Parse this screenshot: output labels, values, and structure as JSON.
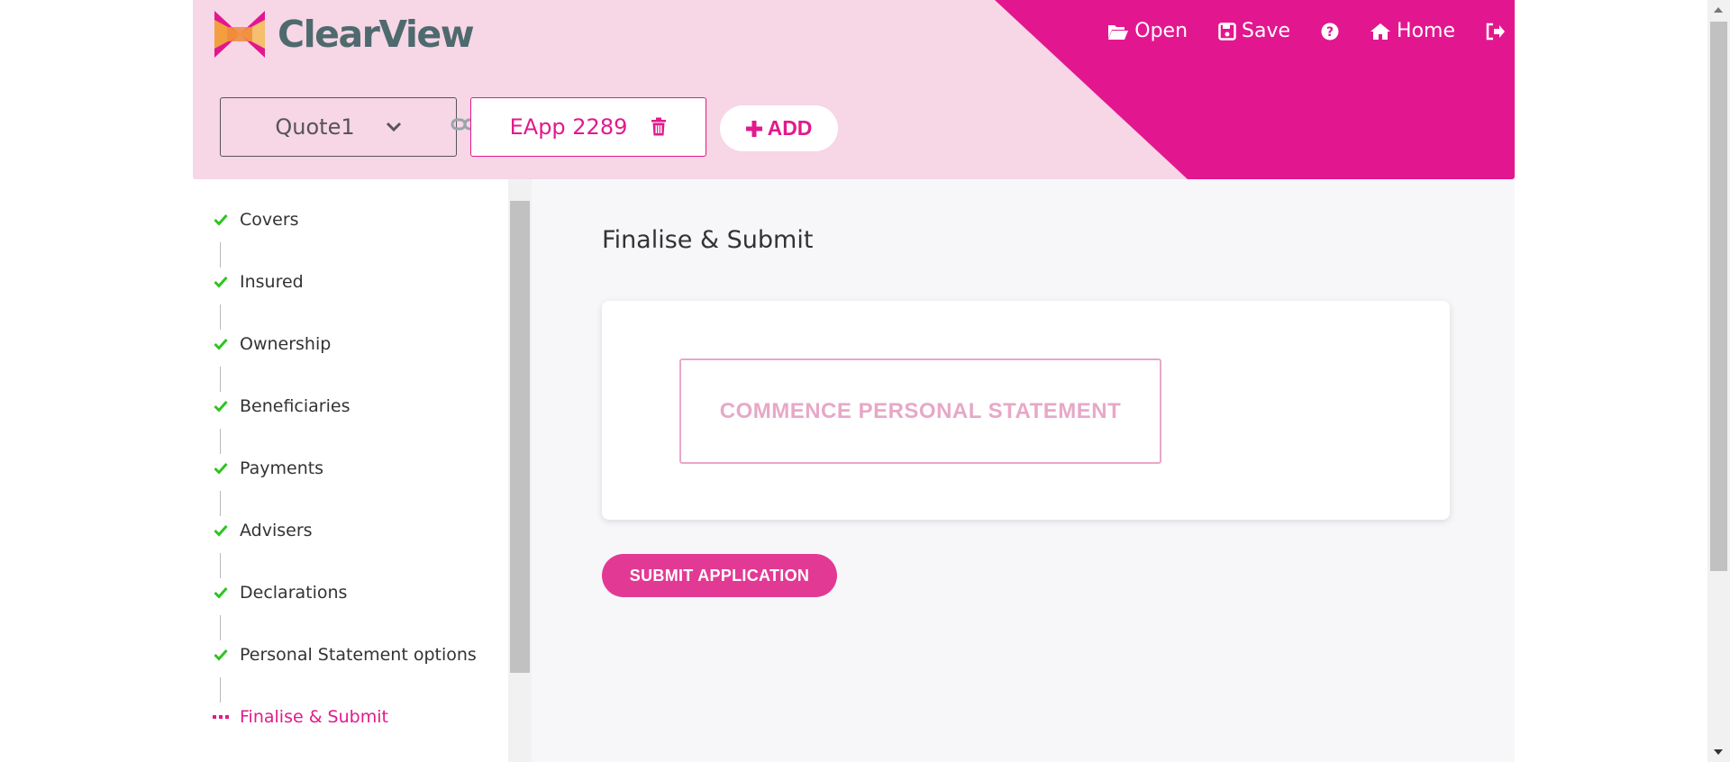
{
  "brand": {
    "name": "ClearView"
  },
  "top_nav": {
    "open_label": "Open",
    "save_label": "Save",
    "home_label": "Home"
  },
  "toolbar": {
    "quote_select_value": "Quote1",
    "eapp_label": "EApp 2289",
    "add_label": "ADD"
  },
  "sidebar": {
    "steps": [
      {
        "label": "Covers",
        "status": "complete"
      },
      {
        "label": "Insured",
        "status": "complete"
      },
      {
        "label": "Ownership",
        "status": "complete"
      },
      {
        "label": "Beneficiaries",
        "status": "complete"
      },
      {
        "label": "Payments",
        "status": "complete"
      },
      {
        "label": "Advisers",
        "status": "complete"
      },
      {
        "label": "Declarations",
        "status": "complete"
      },
      {
        "label": "Personal Statement options",
        "status": "complete"
      },
      {
        "label": "Finalise & Submit",
        "status": "current"
      }
    ]
  },
  "main": {
    "title": "Finalise & Submit",
    "commence_label": "COMMENCE PERSONAL STATEMENT",
    "submit_label": "SUBMIT APPLICATION"
  },
  "colors": {
    "accent": "#e21a8c",
    "header_bg": "#f7d6e6",
    "check": "#2ec41f",
    "logo_text": "#4e6a6e"
  }
}
